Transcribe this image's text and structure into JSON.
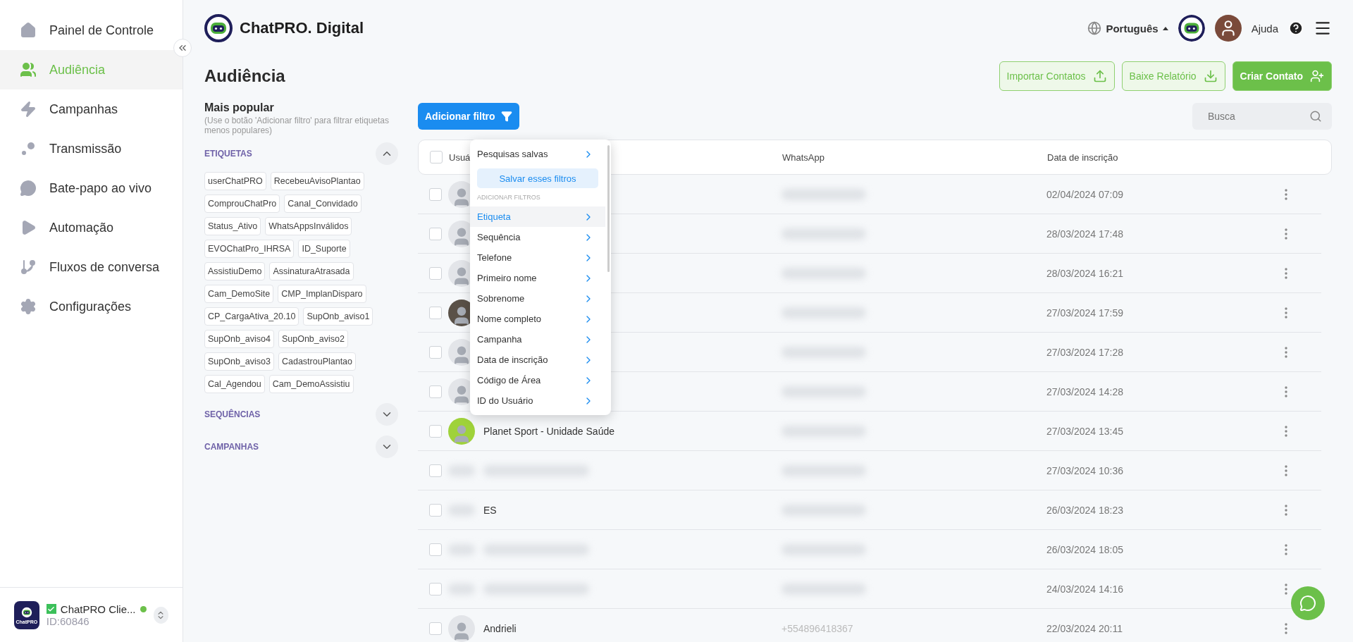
{
  "sidebar": {
    "items": [
      {
        "label": "Painel de Controle",
        "selected": false
      },
      {
        "label": "Audiência",
        "selected": true
      },
      {
        "label": "Campanhas",
        "selected": false
      },
      {
        "label": "Transmissão",
        "selected": false
      },
      {
        "label": "Bate-papo ao vivo",
        "selected": false
      },
      {
        "label": "Automação",
        "selected": false
      },
      {
        "label": "Fluxos de conversa",
        "selected": false
      },
      {
        "label": "Configurações",
        "selected": false
      }
    ],
    "account": {
      "name": "ChatPRO Clie...",
      "id": "ID:60846",
      "checked": true,
      "online": true,
      "logo_text": "ChatPRO"
    }
  },
  "header": {
    "brand": "ChatPRO. Digital",
    "language": "Português",
    "help": "Ajuda"
  },
  "page_title": "Audiência",
  "actions": [
    {
      "label": "Importar Contatos",
      "kind": "import"
    },
    {
      "label": "Baixe Relatório",
      "kind": "download"
    },
    {
      "label": "Criar Contato",
      "kind": "create"
    }
  ],
  "filters": {
    "title": "Mais popular",
    "hint": "(Use o botão 'Adicionar filtro' para filtrar etiquetas menos populares)",
    "sections": [
      {
        "label": "ETIQUETAS",
        "expanded": true,
        "tags": [
          "userChatPRO",
          "RecebeuAvisoPlantao",
          "ComprouChatPro",
          "Canal_Convidado",
          "Status_Ativo",
          "WhatsAppsInválidos",
          "EVOChatPro_IHRSA",
          "ID_Suporte",
          "AssistiuDemo",
          "AssinaturaAtrasada",
          "Cam_DemoSite",
          "CMP_ImplanDisparo",
          "CP_CargaAtiva_20.10",
          "SupOnb_aviso1",
          "SupOnb_aviso4",
          "SupOnb_aviso2",
          "SupOnb_aviso3",
          "CadastrouPlantao",
          "Cal_Agendou",
          "Cam_DemoAssistiu"
        ]
      },
      {
        "label": "SEQUÊNCIAS",
        "expanded": false
      },
      {
        "label": "CAMPANHAS",
        "expanded": false
      }
    ]
  },
  "add_filter": "Adicionar filtro",
  "search": {
    "placeholder": "Busca"
  },
  "filter_menu": {
    "saved": "Pesquisas salvas",
    "save_button": "Salvar esses filtros",
    "section": "ADICIONAR FILTROS",
    "items": [
      {
        "label": "Etiqueta",
        "selected": true
      },
      {
        "label": "Sequência",
        "selected": false
      },
      {
        "label": "Telefone",
        "selected": false
      },
      {
        "label": "Primeiro nome",
        "selected": false
      },
      {
        "label": "Sobrenome",
        "selected": false
      },
      {
        "label": "Nome completo",
        "selected": false
      },
      {
        "label": "Campanha",
        "selected": false
      },
      {
        "label": "Data de inscrição",
        "selected": false
      },
      {
        "label": "Código de Área",
        "selected": false
      },
      {
        "label": "ID do Usuário",
        "selected": false
      }
    ]
  },
  "table": {
    "columns": [
      "Usuá",
      "WhatsApp",
      "Data de inscrição"
    ],
    "header_checked": false,
    "rows": [
      {
        "kind": "placeholder",
        "date": "02/04/2024 07:09",
        "checked": false
      },
      {
        "kind": "placeholder",
        "date": "28/03/2024 17:48",
        "checked": false
      },
      {
        "kind": "placeholder",
        "date": "28/03/2024 16:21",
        "checked": false
      },
      {
        "kind": "photo",
        "date": "27/03/2024 17:59",
        "checked": false
      },
      {
        "kind": "placeholder",
        "date": "27/03/2024 17:28",
        "checked": false
      },
      {
        "kind": "placeholder",
        "date": "27/03/2024 14:28",
        "checked": false
      },
      {
        "kind": "green",
        "name": "Planet Sport - Unidade Saúde",
        "date": "27/03/2024 13:45",
        "checked": false
      },
      {
        "kind": "blurred",
        "date": "27/03/2024 10:36",
        "checked": false
      },
      {
        "kind": "blurred",
        "name": "ES",
        "date": "26/03/2024 18:23",
        "checked": false
      },
      {
        "kind": "blurred",
        "date": "26/03/2024 18:05",
        "checked": false
      },
      {
        "kind": "blurred",
        "date": "24/03/2024 14:16",
        "checked": false
      },
      {
        "kind": "placeholder",
        "name": "Andrieli",
        "whatsapp": "+554896418367",
        "date": "22/03/2024 20:11",
        "checked": false
      }
    ]
  }
}
